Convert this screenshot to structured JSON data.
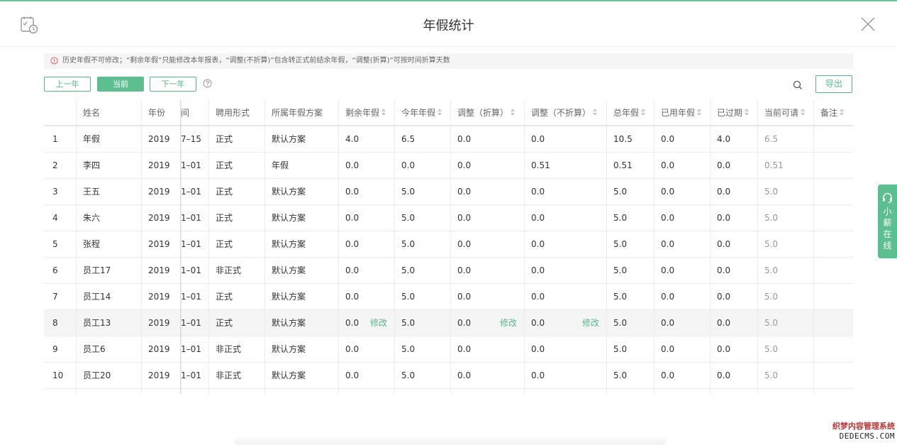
{
  "dialog": {
    "title": "年假统计"
  },
  "notice": {
    "text": "历史年假不可修改；“剩余年假”只能修改本年报表，“调整(不折算)”包含转正式前结余年假，“调整(折算)”可按时间折算天数"
  },
  "toolbar": {
    "prev_year": "上一年",
    "current": "当前",
    "next_year": "下一年",
    "export": "导出"
  },
  "table": {
    "headers": [
      "",
      "姓名",
      "年份",
      "间",
      "聘用形式",
      "所属年假方案",
      "剩余年假",
      "今年年假",
      "调整（折算）",
      "调整（不折算）",
      "总年假",
      "已用年假",
      "已过期",
      "当前可请",
      "备注"
    ],
    "rows": [
      [
        "1",
        "年假",
        "2019",
        "7–15",
        "正式",
        "默认方案",
        "4.0",
        "6.5",
        "0.0",
        "0.0",
        "10.5",
        "0.0",
        "4.0",
        "6.5",
        ""
      ],
      [
        "2",
        "李四",
        "2019",
        "1–01",
        "正式",
        "年假",
        "0.0",
        "0.0",
        "0.0",
        "0.51",
        "0.51",
        "0.0",
        "0.0",
        "0.51",
        ""
      ],
      [
        "3",
        "王五",
        "2019",
        "1–01",
        "正式",
        "默认方案",
        "0.0",
        "5.0",
        "0.0",
        "0.0",
        "5.0",
        "0.0",
        "0.0",
        "5.0",
        ""
      ],
      [
        "4",
        "朱六",
        "2019",
        "1–01",
        "正式",
        "默认方案",
        "0.0",
        "5.0",
        "0.0",
        "0.0",
        "5.0",
        "0.0",
        "0.0",
        "5.0",
        ""
      ],
      [
        "5",
        "张程",
        "2019",
        "1–01",
        "正式",
        "默认方案",
        "0.0",
        "5.0",
        "0.0",
        "0.0",
        "5.0",
        "0.0",
        "0.0",
        "5.0",
        ""
      ],
      [
        "6",
        "员工17",
        "2019",
        "1–01",
        "非正式",
        "默认方案",
        "0.0",
        "5.0",
        "0.0",
        "0.0",
        "5.0",
        "0.0",
        "0.0",
        "5.0",
        ""
      ],
      [
        "7",
        "员工14",
        "2019",
        "1–01",
        "正式",
        "默认方案",
        "0.0",
        "5.0",
        "0.0",
        "0.0",
        "5.0",
        "0.0",
        "0.0",
        "5.0",
        ""
      ],
      [
        "8",
        "员工13",
        "2019",
        "1–01",
        "正式",
        "默认方案",
        "0.0",
        "5.0",
        "0.0",
        "0.0",
        "5.0",
        "0.0",
        "0.0",
        "5.0",
        ""
      ],
      [
        "9",
        "员工6",
        "2019",
        "1–01",
        "非正式",
        "默认方案",
        "0.0",
        "5.0",
        "0.0",
        "0.0",
        "5.0",
        "0.0",
        "0.0",
        "5.0",
        ""
      ],
      [
        "10",
        "员工20",
        "2019",
        "1–01",
        "非正式",
        "默认方案",
        "0.0",
        "5.0",
        "0.0",
        "0.0",
        "5.0",
        "0.0",
        "0.0",
        "5.0",
        ""
      ]
    ],
    "edit_label": "修改",
    "highlight_row": 7
  },
  "side_tab": {
    "text": "小薪在线"
  },
  "watermark": {
    "line1": "织梦内容管理系统",
    "line2": "DEDECMS.COM"
  },
  "colors": {
    "accent": "#5dbf8f",
    "warning": "#e55"
  },
  "icons": {
    "header": "calendar-clock-icon",
    "close": "close-icon",
    "help": "help-circle-icon",
    "search": "search-icon",
    "support": "headset-icon",
    "notice": "warning-icon"
  }
}
